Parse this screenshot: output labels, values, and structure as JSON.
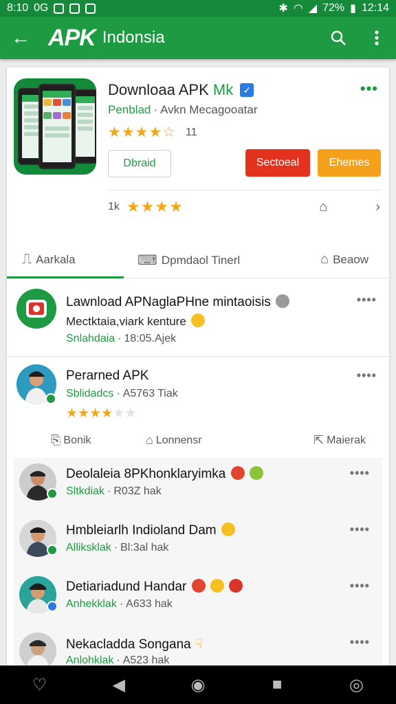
{
  "status_bar": {
    "time_left": "8:10",
    "carrier": "0G",
    "battery": "72%",
    "time_right": "12:14"
  },
  "app_bar": {
    "logo": "APK",
    "title": "Indonsia",
    "background": "#1e9a43"
  },
  "app_header": {
    "name": "Downloaa APK",
    "name_suffix": "Mk",
    "developer": "Penblad",
    "developer_sub": "Avkn Mecagooatar",
    "rating_stars": "★★★★☆",
    "rating_count": "11",
    "buttons": {
      "detail": "Dbraid",
      "secondary": "Sectoeal",
      "themes": "Ehemes"
    },
    "stat_count": "1k",
    "stat_stars": "★★★★"
  },
  "tabs": [
    {
      "label": "Aarkala"
    },
    {
      "label": "Dpmdaol Tinerl"
    },
    {
      "label": "Beaow"
    }
  ],
  "items": [
    {
      "title": "Lawnload APNaglaPHne mintaoisis",
      "subtitle": "Mectktaia,viark kenture",
      "meta_name": "Snlahdaia",
      "meta_time": "18:05.Ajek"
    },
    {
      "title": "Perarned APK",
      "meta_name": "Sblidadcs",
      "meta_time": "A5763 Tiak",
      "stars": "★★★★",
      "stars_empty": "★★"
    }
  ],
  "actions": {
    "bookmark": "Bonik",
    "comments": "Lonnensr",
    "share": "Maierak"
  },
  "sub_items": [
    {
      "title": "Deolaleia 8PKhonklaryimka",
      "meta_name": "Sltkdiak",
      "meta_time": "R03Z hak"
    },
    {
      "title": "Hmbleiarlh Indioland Dam",
      "meta_name": "Alliksklak",
      "meta_time": "Bl:3al hak"
    },
    {
      "title": "Detiariadund Handar",
      "meta_name": "Anhekklak",
      "meta_time": "A633 hak"
    },
    {
      "title": "Nekacladda Songana",
      "meta_name": "Anlohklak",
      "meta_time": "A523 hak"
    }
  ]
}
